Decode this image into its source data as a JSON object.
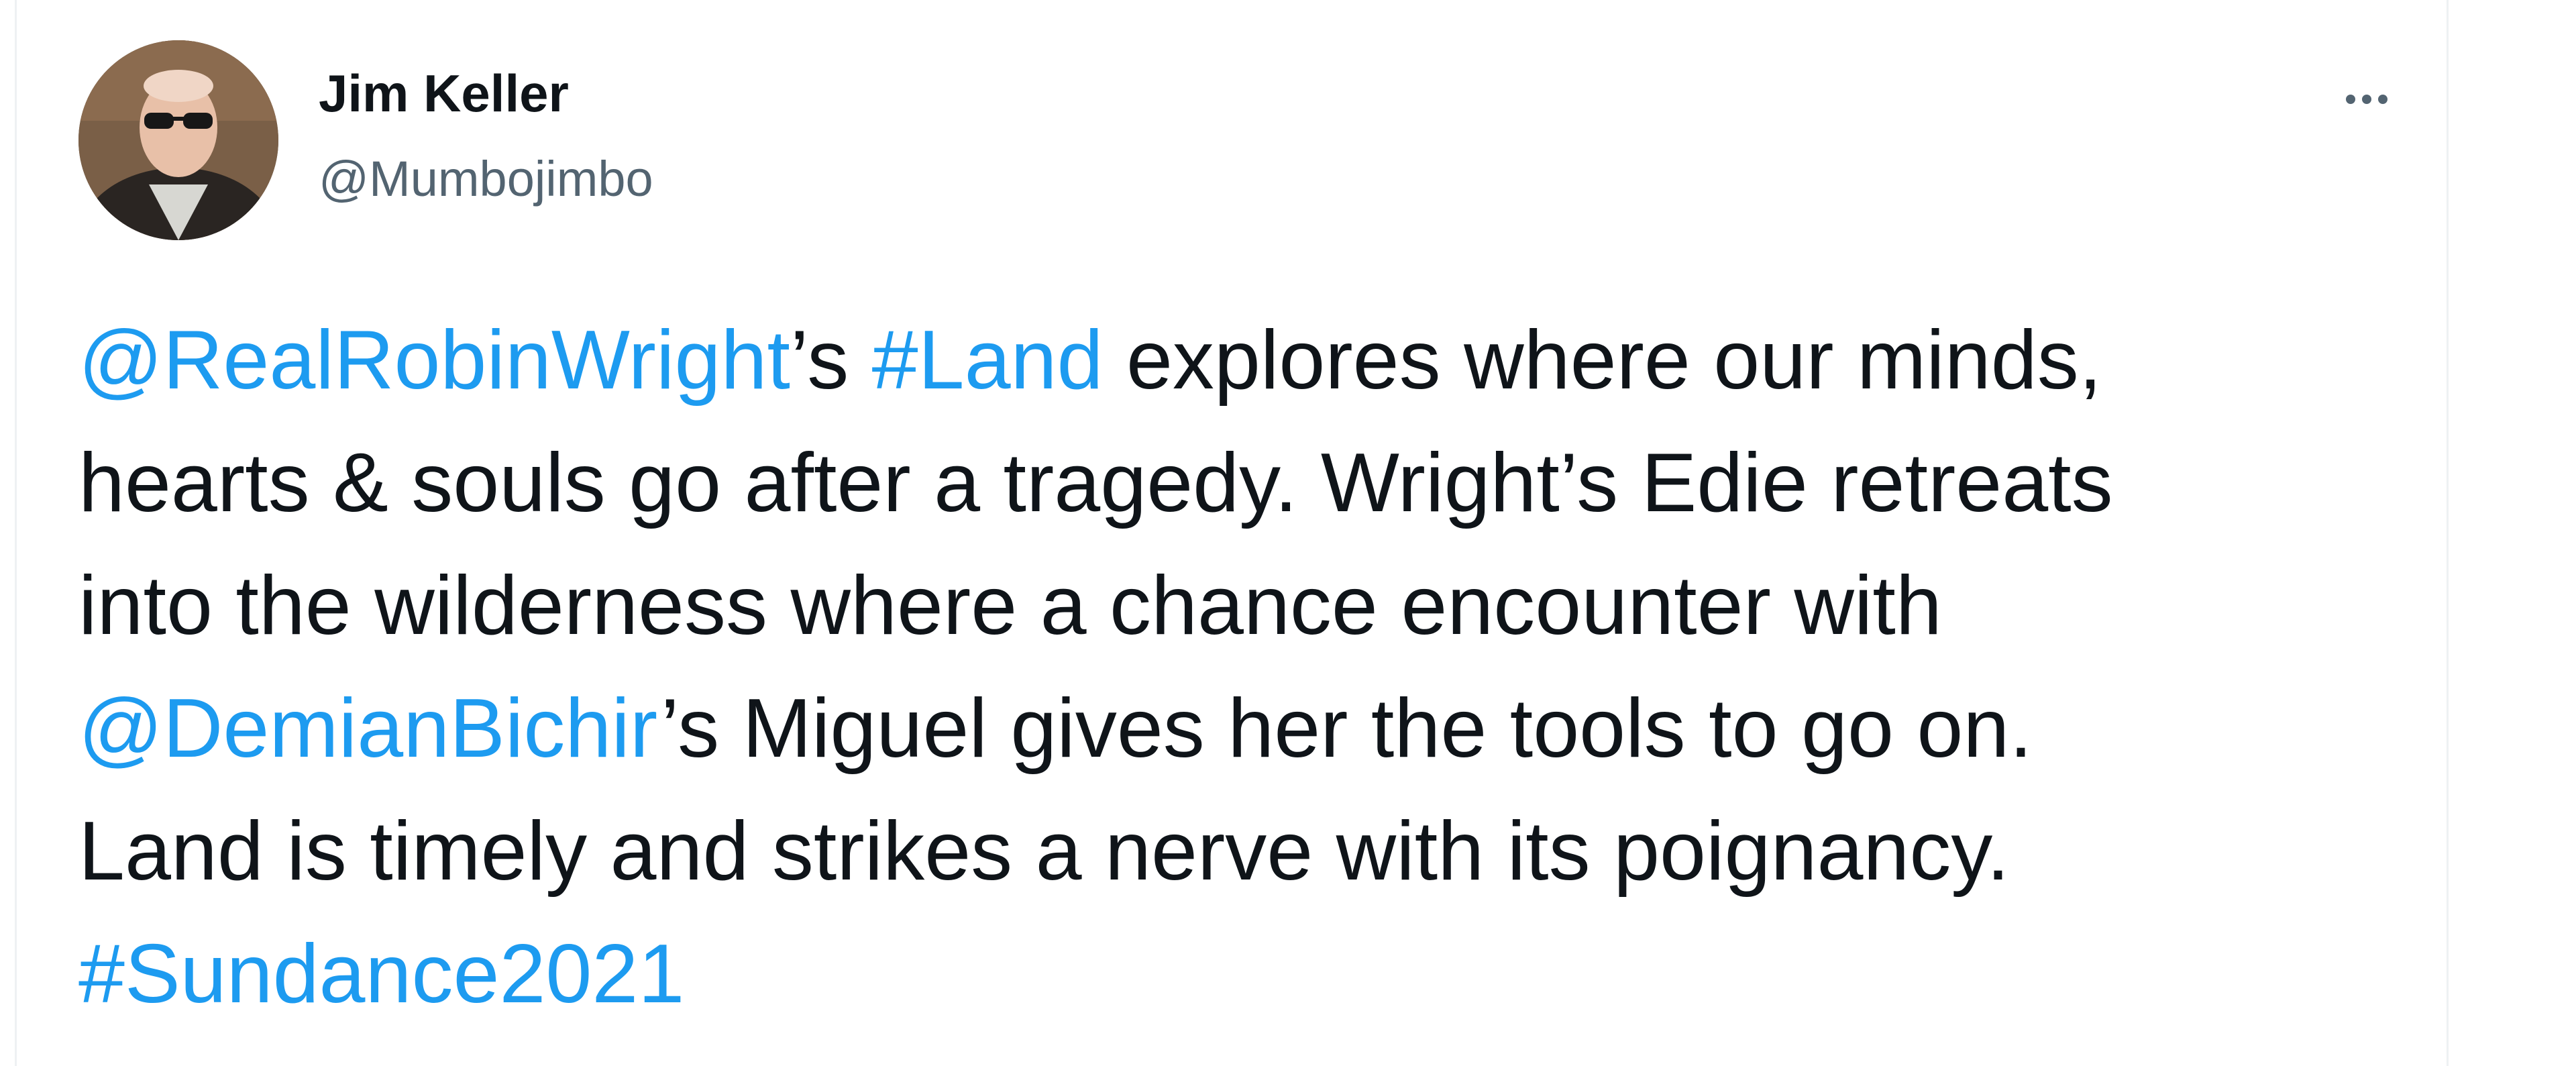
{
  "author": {
    "display_name": "Jim Keller",
    "handle": "@Mumbojimbo"
  },
  "more_icon": "more-horizontal-icon",
  "colors": {
    "link": "#1d9bf0",
    "text": "#0f1419",
    "secondary": "#536471"
  },
  "tweet": {
    "line1": {
      "mention1": "@RealRobinWright",
      "text1": "’s ",
      "hashtag1": "#Land",
      "text2": " explores where our minds,"
    },
    "line2": "hearts & souls go after a tragedy. Wright’s Edie retreats",
    "line3": "into the wilderness where a chance encounter with",
    "line4": {
      "mention2": "@DemianBichir",
      "text3": "’s Miguel gives her the tools to go on."
    },
    "line5": "Land is timely and strikes a nerve with its poignancy.",
    "hashtag2": "#Sundance2021"
  }
}
